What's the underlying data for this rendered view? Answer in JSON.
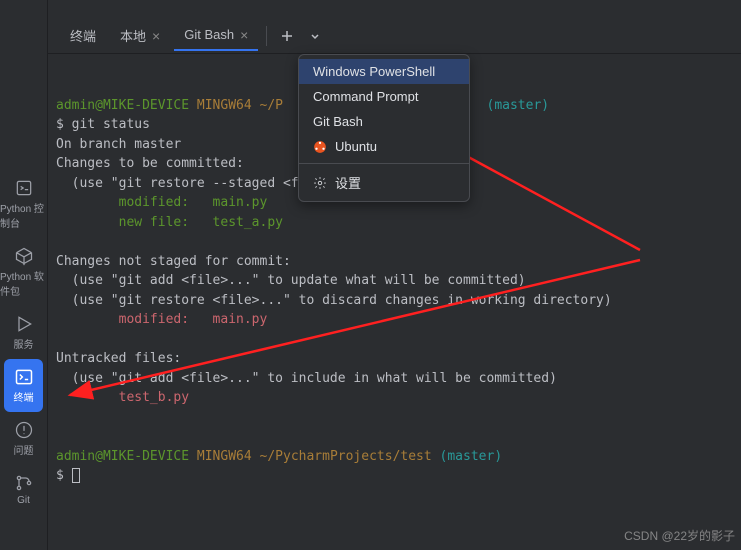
{
  "sidebar": {
    "items": [
      {
        "label": "Python\n控制台"
      },
      {
        "label": "Python\n软件包"
      },
      {
        "label": "服务"
      },
      {
        "label": "终端"
      },
      {
        "label": "问题"
      },
      {
        "label": "Git"
      }
    ]
  },
  "tabs": {
    "t0": "终端",
    "t1": "本地",
    "t2": "Git Bash"
  },
  "menu": {
    "i0": "Windows PowerShell",
    "i1": "Command Prompt",
    "i2": "Git Bash",
    "i3": "Ubuntu",
    "settings": "设置"
  },
  "term": {
    "user": "admin@MIKE-DEVICE",
    "sys": "MINGW64",
    "path": "~/PycharmProjects/test",
    "path_cut": "~/P",
    "branch": "(master)",
    "l1": "$ git status",
    "l2": "On branch master",
    "l3": "Changes to be committed:",
    "l4": "  (use \"git restore --staged <file>...\" to unstage)",
    "l5a": "        modified:   ",
    "l5b": "main.py",
    "l6a": "        new file:   ",
    "l6b": "test_a.py",
    "l7": "Changes not staged for commit:",
    "l8": "  (use \"git add <file>...\" to update what will be committed)",
    "l9": "  (use \"git restore <file>...\" to discard changes in working directory)",
    "l10a": "        modified:   ",
    "l10b": "main.py",
    "l11": "Untracked files:",
    "l12": "  (use \"git add <file>...\" to include in what will be committed)",
    "l13": "        test_b.py",
    "prompt": "$ "
  },
  "watermark": "CSDN @22岁的影子"
}
